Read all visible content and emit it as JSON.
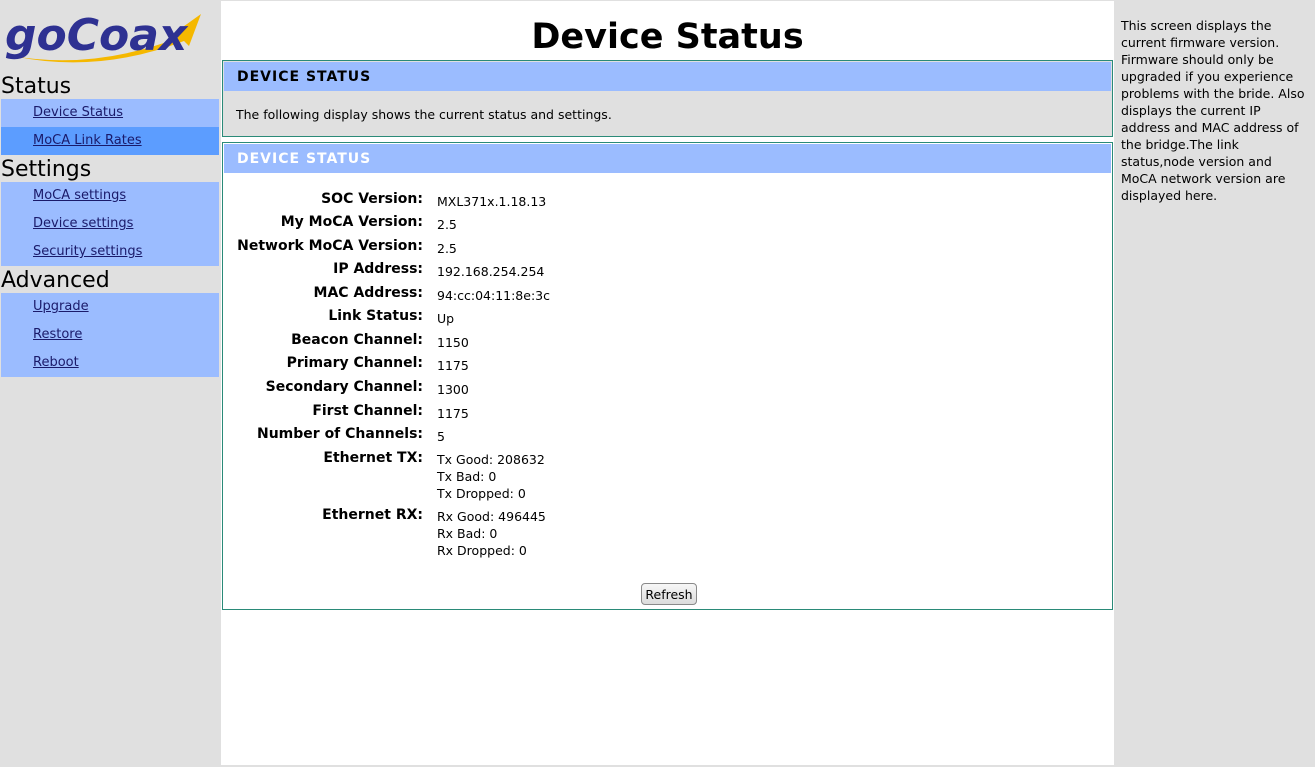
{
  "logo": {
    "text": "goCoax"
  },
  "sidebar": {
    "sections": [
      {
        "title": "Status",
        "items": [
          {
            "label": "Device Status"
          },
          {
            "label": "MoCA Link Rates"
          }
        ]
      },
      {
        "title": "Settings",
        "items": [
          {
            "label": "MoCA settings"
          },
          {
            "label": "Device settings"
          },
          {
            "label": "Security settings"
          }
        ]
      },
      {
        "title": "Advanced",
        "items": [
          {
            "label": "Upgrade"
          },
          {
            "label": "Restore"
          },
          {
            "label": "Reboot"
          }
        ]
      }
    ],
    "active_item": "MoCA Link Rates"
  },
  "main": {
    "title": "Device Status",
    "panel1": {
      "heading": "DEVICE STATUS",
      "description": "The following display shows the current status and settings."
    },
    "panel2": {
      "heading": "DEVICE STATUS",
      "rows": [
        {
          "label": "SOC Version:",
          "value": "MXL371x.1.18.13"
        },
        {
          "label": "My MoCA Version:",
          "value": "2.5"
        },
        {
          "label": "Network MoCA Version:",
          "value": "2.5"
        },
        {
          "label": "IP Address:",
          "value": "192.168.254.254"
        },
        {
          "label": "MAC Address:",
          "value": "94:cc:04:11:8e:3c"
        },
        {
          "label": "Link Status:",
          "value": "Up"
        },
        {
          "label": "Beacon Channel:",
          "value": "1150"
        },
        {
          "label": "Primary Channel:",
          "value": "1175"
        },
        {
          "label": "Secondary Channel:",
          "value": "1300"
        },
        {
          "label": "First Channel:",
          "value": "1175"
        },
        {
          "label": "Number of Channels:",
          "value": "5"
        },
        {
          "label": "Ethernet TX:",
          "lines": [
            "Tx Good: 208632",
            "Tx Bad: 0",
            "Tx Dropped: 0"
          ]
        },
        {
          "label": "Ethernet RX:",
          "lines": [
            "Rx Good: 496445",
            "Rx Bad: 0",
            "Rx Dropped: 0"
          ]
        }
      ],
      "refresh_label": "Refresh"
    }
  },
  "help": {
    "text": "This screen displays the current firmware version. Firmware should only be upgraded if you experience problems with the bride. Also displays the current IP address and MAC address of the bridge.The link status,node version and MoCA network version are displayed here."
  },
  "colors": {
    "nav_bg": "#9bbcff",
    "nav_active": "#5c9dff",
    "panel_border": "#2a8a78",
    "logo_blue": "#2e3192",
    "logo_arrow": "#f5b800"
  }
}
